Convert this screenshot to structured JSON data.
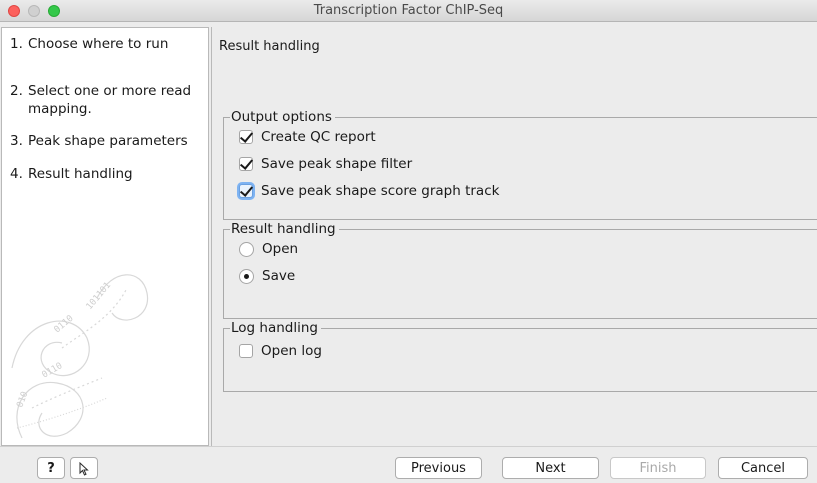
{
  "window": {
    "title": "Transcription Factor ChIP-Seq"
  },
  "steps": [
    {
      "num": "1.",
      "label": "Choose where to run"
    },
    {
      "num": "2.",
      "label": "Select one or more read mapping."
    },
    {
      "num": "3.",
      "label": "Peak shape parameters"
    },
    {
      "num": "4.",
      "label": "Result handling"
    }
  ],
  "main": {
    "header": "Result handling",
    "output_options": {
      "title": "Output options",
      "items": [
        {
          "label": "Create QC report",
          "checked": true
        },
        {
          "label": "Save peak shape filter",
          "checked": true
        },
        {
          "label": "Save peak shape score graph track",
          "checked": true
        }
      ]
    },
    "result_handling": {
      "title": "Result handling",
      "options": [
        {
          "label": "Open",
          "selected": false
        },
        {
          "label": "Save",
          "selected": true
        }
      ]
    },
    "log_handling": {
      "title": "Log handling",
      "items": [
        {
          "label": "Open log",
          "checked": false
        }
      ]
    }
  },
  "footer": {
    "help_label": "?",
    "previous_label": "Previous",
    "next_label": "Next",
    "finish_label": "Finish",
    "cancel_label": "Cancel"
  },
  "colors": {
    "close": "#fc615d",
    "minimize": "#d0d0d0",
    "maximize": "#34c84a",
    "focus_ring": "#7eb3f2"
  }
}
